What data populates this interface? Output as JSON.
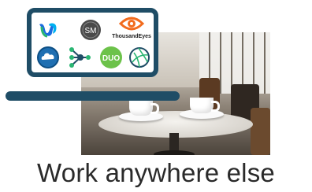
{
  "headline": "Work anywhere else",
  "apps": [
    {
      "name": "webex-icon",
      "color": "#1a6be0"
    },
    {
      "name": "sm-icon",
      "label": "SM",
      "color": "#444444"
    },
    {
      "name": "thousandeyes-icon",
      "label": "ThousandEyes",
      "color": "#f26b1d"
    },
    {
      "name": "cloud-shield-icon",
      "color": "#1f6fb2"
    },
    {
      "name": "network-graph-icon",
      "color": "#2bb673"
    },
    {
      "name": "duo-icon",
      "label": "DUO",
      "color": "#6cc24a"
    },
    {
      "name": "globe-icon",
      "color": "#1f4d66"
    }
  ],
  "colors": {
    "frame": "#1f4d66",
    "text": "#2a2a2a"
  }
}
